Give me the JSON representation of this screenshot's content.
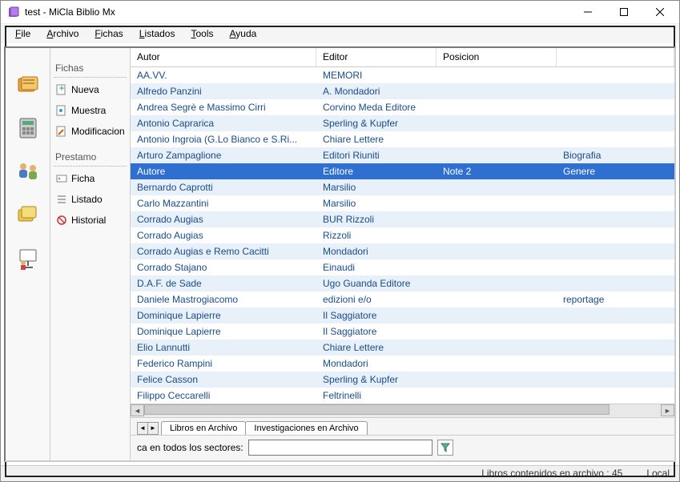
{
  "window": {
    "title": "test - MiCla Biblio Mx"
  },
  "menu": {
    "items": [
      {
        "label": "File",
        "mnemonic": 0
      },
      {
        "label": "Archivo",
        "mnemonic": 0
      },
      {
        "label": "Fichas",
        "mnemonic": 0
      },
      {
        "label": "Listados",
        "mnemonic": 0
      },
      {
        "label": "Tools",
        "mnemonic": 0
      },
      {
        "label": "Ayuda",
        "mnemonic": 0
      }
    ]
  },
  "sidebar": {
    "group1_label": "Fichas",
    "nueva": "Nueva",
    "muestra": "Muestra",
    "modificacion": "Modificacion",
    "group2_label": "Prestamo",
    "ficha": "Ficha",
    "listado": "Listado",
    "historial": "Historial"
  },
  "table": {
    "headers": {
      "autor": "Autor",
      "editor": "Editor",
      "posicion": "Posicion",
      "extra": ""
    },
    "rows": [
      {
        "autor": "AA.VV.",
        "editor": "MEMORI",
        "posicion": "",
        "extra": ""
      },
      {
        "autor": "Alfredo Panzini",
        "editor": "A. Mondadori",
        "posicion": "",
        "extra": ""
      },
      {
        "autor": "Andrea Segrè e Massimo Cirri",
        "editor": "Corvino Meda Editore",
        "posicion": "",
        "extra": ""
      },
      {
        "autor": "Antonio Caprarica",
        "editor": "Sperling & Kupfer",
        "posicion": "",
        "extra": ""
      },
      {
        "autor": "Antonio Ingroia (G.Lo Bianco e S.Ri...",
        "editor": "Chiare Lettere",
        "posicion": "",
        "extra": ""
      },
      {
        "autor": "Arturo Zampaglione",
        "editor": "Editori Riuniti",
        "posicion": "",
        "extra": "Biografia"
      },
      {
        "autor": "Autore",
        "editor": "Editore",
        "posicion": "Note 2",
        "extra": "Genere",
        "selected": true
      },
      {
        "autor": "Bernardo Caprotti",
        "editor": "Marsilio",
        "posicion": "",
        "extra": ""
      },
      {
        "autor": "Carlo Mazzantini",
        "editor": "Marsilio",
        "posicion": "",
        "extra": ""
      },
      {
        "autor": "Corrado Augias",
        "editor": "BUR Rizzoli",
        "posicion": "",
        "extra": ""
      },
      {
        "autor": "Corrado Augias",
        "editor": "Rizzoli",
        "posicion": "",
        "extra": ""
      },
      {
        "autor": "Corrado Augias e Remo Cacitti",
        "editor": "Mondadori",
        "posicion": "",
        "extra": ""
      },
      {
        "autor": "Corrado Stajano",
        "editor": "Einaudi",
        "posicion": "",
        "extra": ""
      },
      {
        "autor": "D.A.F. de Sade",
        "editor": "Ugo Guanda Editore",
        "posicion": "",
        "extra": ""
      },
      {
        "autor": "Daniele Mastrogiacomo",
        "editor": "edizioni e/o",
        "posicion": "",
        "extra": "reportage"
      },
      {
        "autor": "Dominique Lapierre",
        "editor": "Il Saggiatore",
        "posicion": "",
        "extra": ""
      },
      {
        "autor": "Dominique Lapierre",
        "editor": "Il Saggiatore",
        "posicion": "",
        "extra": ""
      },
      {
        "autor": "Elio Lannutti",
        "editor": "Chiare Lettere",
        "posicion": "",
        "extra": ""
      },
      {
        "autor": "Federico Rampini",
        "editor": "Mondadori",
        "posicion": "",
        "extra": ""
      },
      {
        "autor": "Felice Casson",
        "editor": "Sperling & Kupfer",
        "posicion": "",
        "extra": ""
      },
      {
        "autor": "Filippo Ceccarelli",
        "editor": "Feltrinelli",
        "posicion": "",
        "extra": ""
      }
    ]
  },
  "tabs": {
    "tab1": "Libros en Archivo",
    "tab2": "Investigaciones en Archivo"
  },
  "search": {
    "label": "ca en todos los sectores:",
    "value": ""
  },
  "status": {
    "count": "Libros contenidos en archivo : 45",
    "mode": "Local"
  }
}
